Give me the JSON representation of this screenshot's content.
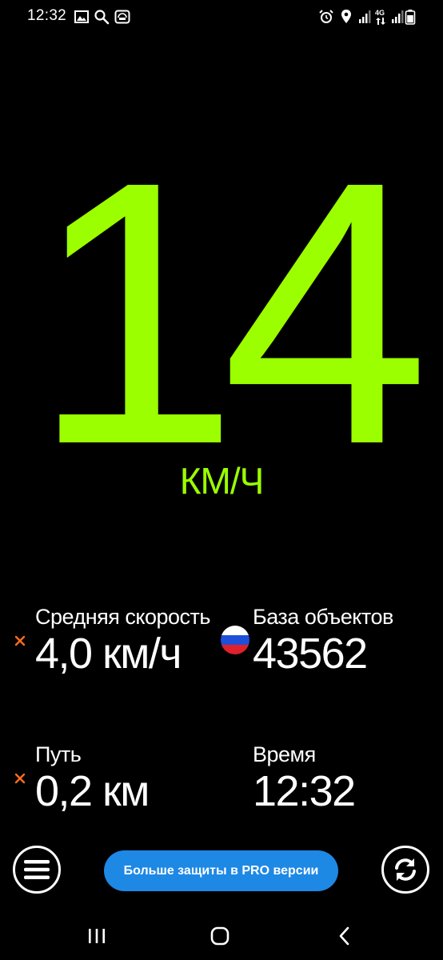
{
  "status_bar": {
    "time": "12:32",
    "network": "4G"
  },
  "speedometer": {
    "speed": "14",
    "unit": "КМ/Ч"
  },
  "stats": {
    "avg_speed": {
      "label": "Средняя скорость",
      "value": "4,0 км/ч"
    },
    "database": {
      "label": "База объектов",
      "value": "43562"
    },
    "distance": {
      "label": "Путь",
      "value": "0,2 км"
    },
    "time": {
      "label": "Время",
      "value": "12:32"
    }
  },
  "controls": {
    "promo_label": "Больше защиты в PRO версии"
  },
  "colors": {
    "speed": "#9cff00",
    "accent_button": "#1e88e5",
    "reset_icon": "#ff6d1f"
  }
}
